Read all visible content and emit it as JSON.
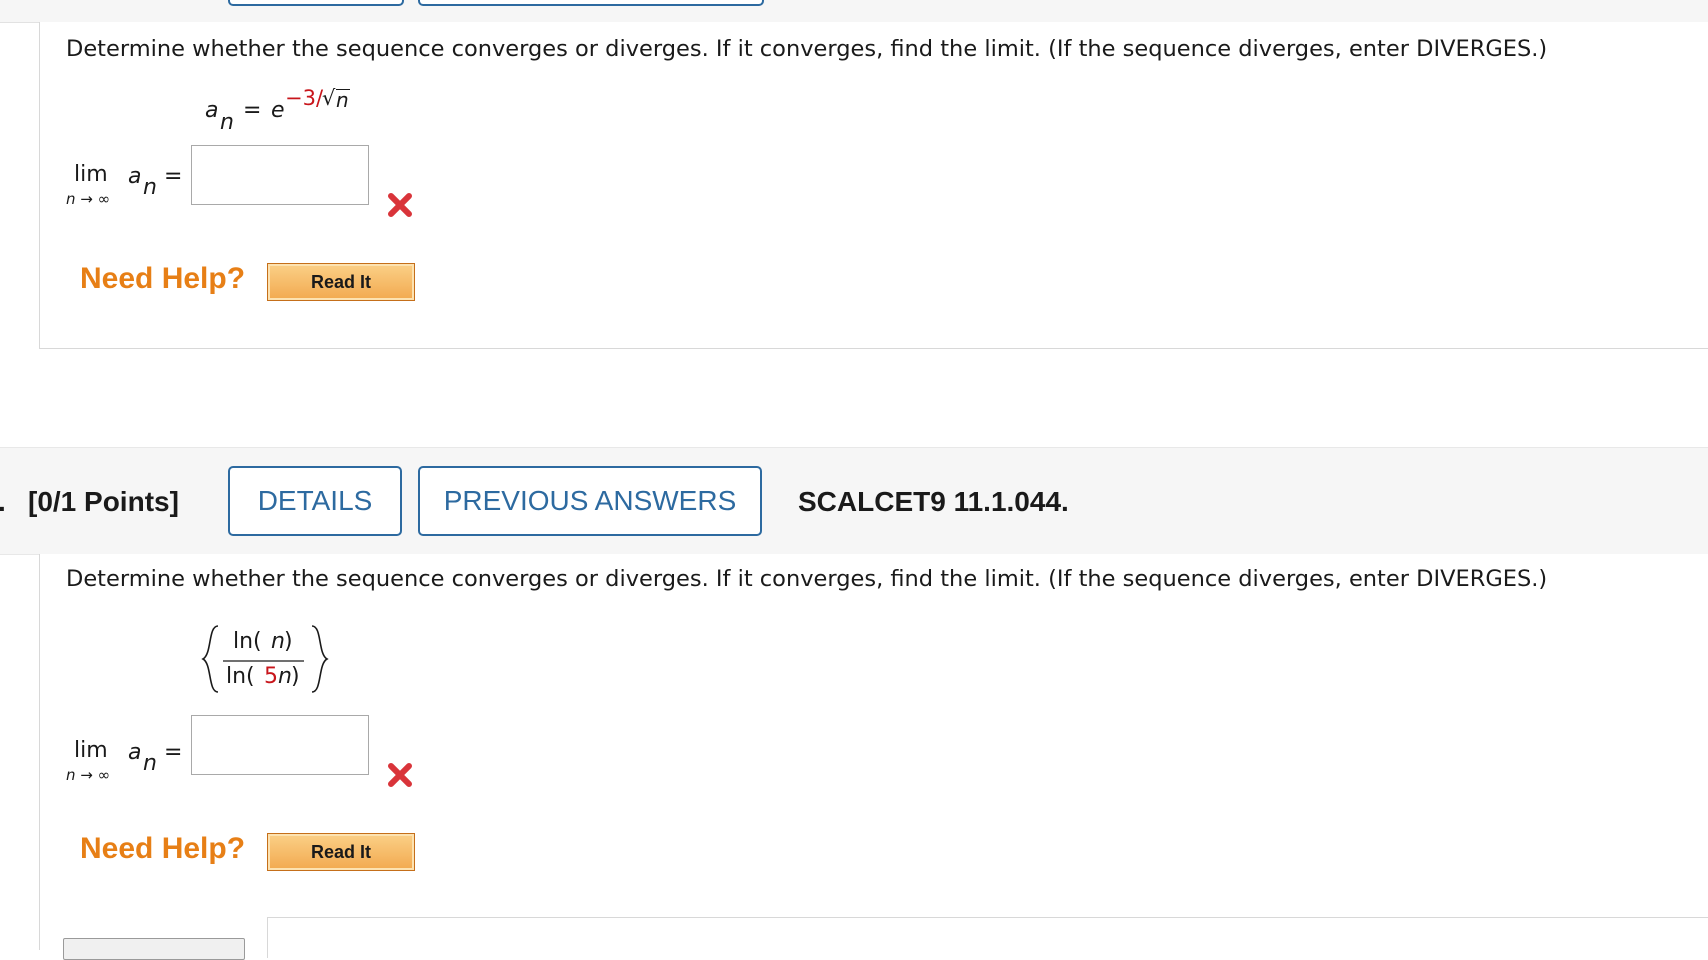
{
  "question1": {
    "prompt": "Determine whether the sequence converges or diverges. If it converges, find the limit. (If the sequence diverges, enter DIVERGES.)",
    "formula": {
      "lhs_var": "a",
      "lhs_sub": "n",
      "equals": "=",
      "base": "e",
      "exponent_red": "−3/",
      "exponent_radical": "√",
      "exponent_var": "n"
    },
    "limit": {
      "word": "lim",
      "var": "a",
      "sub": "n",
      "under": "n → ∞",
      "equals": "="
    },
    "answer_value": "",
    "status": "incorrect",
    "need_help_label": "Need Help?",
    "read_it_label": "Read It"
  },
  "question2": {
    "points_label": "[0/1 Points]",
    "points_prefix": ".",
    "details_label": "DETAILS",
    "previous_answers_label": "PREVIOUS ANSWERS",
    "reference": "SCALCET9 11.1.044.",
    "prompt": "Determine whether the sequence converges or diverges. If it converges, find the limit. (If the sequence diverges, enter DIVERGES.)",
    "formula": {
      "numerator_fn": "ln(",
      "numerator_var": "n",
      "numerator_close": ")",
      "denominator_fn": "ln(",
      "denominator_red": "5",
      "denominator_var": "n",
      "denominator_close": ")"
    },
    "limit": {
      "word": "lim",
      "var": "a",
      "sub": "n",
      "under": "n → ∞",
      "equals": "="
    },
    "answer_value": "",
    "status": "incorrect",
    "need_help_label": "Need Help?",
    "read_it_label": "Read It"
  },
  "colors": {
    "accent_blue": "#2d6aa0",
    "help_orange": "#e77f16",
    "error_red": "#d9343a",
    "math_red": "#c8151b"
  },
  "icons": [
    "x-mark-icon",
    "x-mark-icon"
  ]
}
